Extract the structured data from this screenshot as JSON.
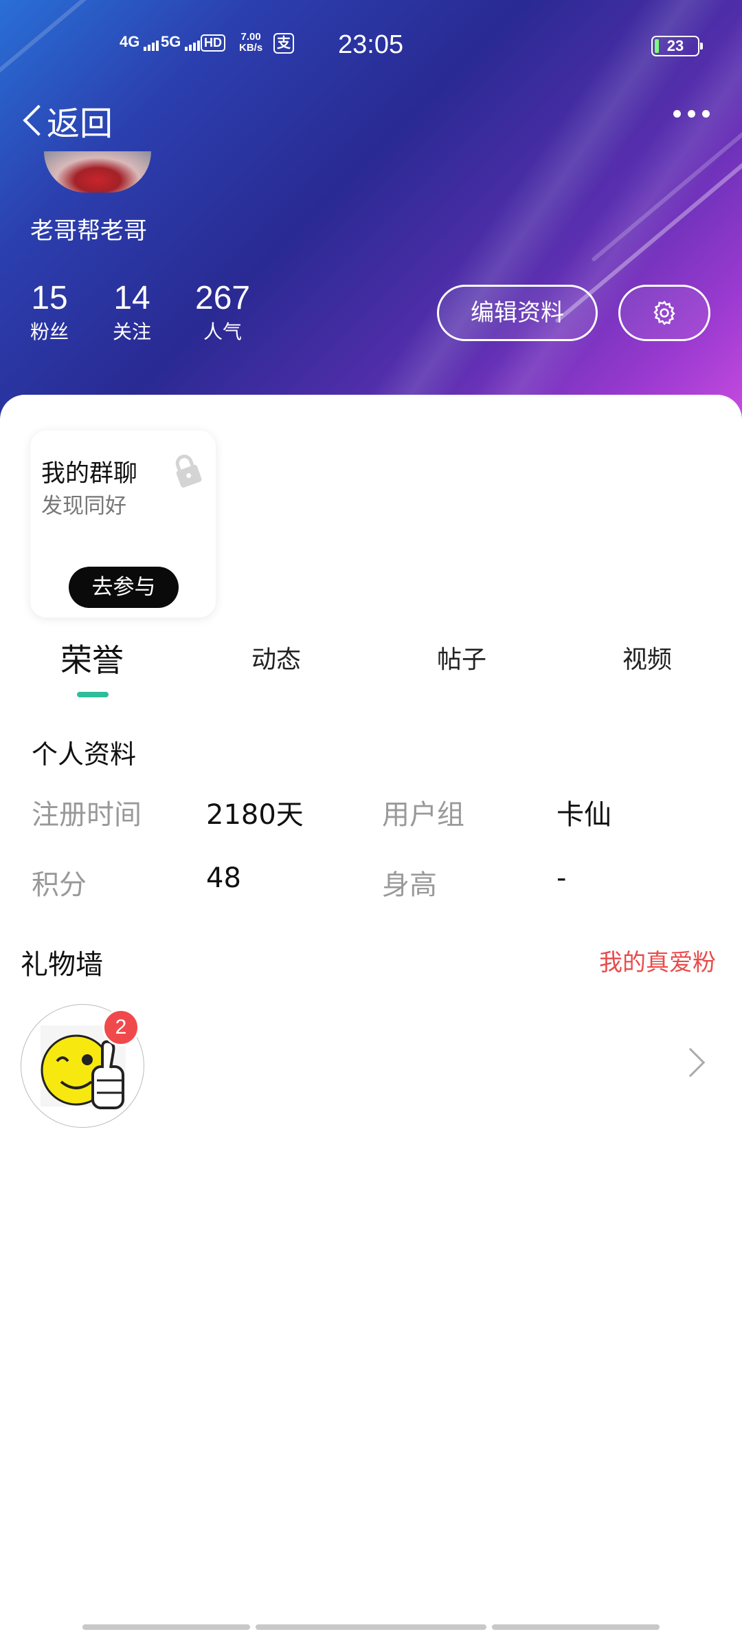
{
  "status_bar": {
    "network_1": "4G",
    "network_2": "5G",
    "hd": "HD",
    "speed_value": "7.00",
    "speed_unit": "KB/s",
    "pay_icon": "支",
    "time": "23:05",
    "battery": "23"
  },
  "header": {
    "back_label": "返回",
    "username": "老哥帮老哥",
    "stats": [
      {
        "value": "15",
        "label": "粉丝"
      },
      {
        "value": "14",
        "label": "关注"
      },
      {
        "value": "267",
        "label": "人气"
      }
    ],
    "edit_profile_label": "编辑资料"
  },
  "group_card": {
    "title": "我的群聊",
    "subtitle": "发现同好",
    "join_label": "去参与"
  },
  "tabs": [
    {
      "label": "荣誉",
      "active": true
    },
    {
      "label": "动态",
      "active": false
    },
    {
      "label": "帖子",
      "active": false
    },
    {
      "label": "视频",
      "active": false
    }
  ],
  "profile": {
    "section_title": "个人资料",
    "fields": [
      {
        "label": "注册时间",
        "value": "2180天"
      },
      {
        "label": "用户组",
        "value": "卡仙"
      },
      {
        "label": "积分",
        "value": "48"
      },
      {
        "label": "身高",
        "value": "-"
      }
    ]
  },
  "gift_wall": {
    "title": "礼物墙",
    "link_label": "我的真爱粉",
    "gift_count": "2"
  },
  "colors": {
    "accent_tab": "#2ebd9b",
    "link_red": "#e94b4b",
    "badge_red": "#f0494c"
  }
}
